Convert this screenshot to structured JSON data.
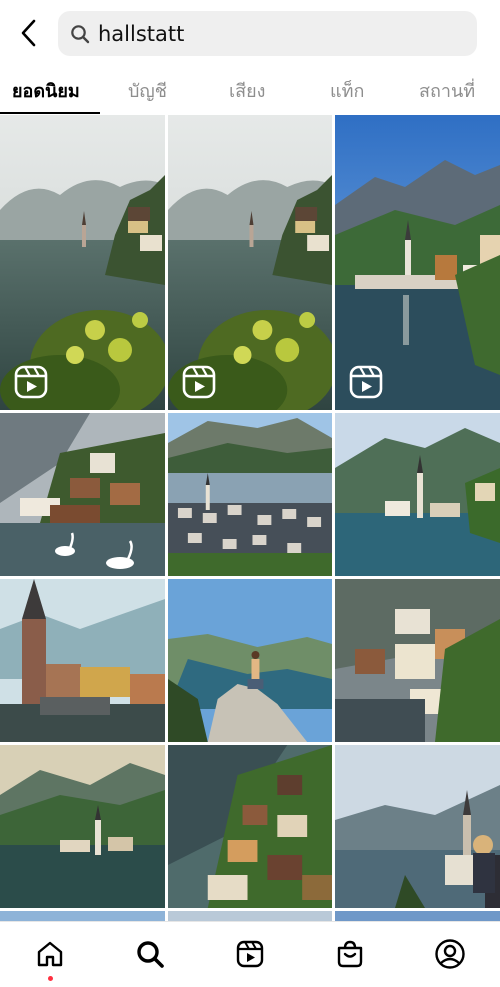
{
  "search": {
    "query": "hallstatt"
  },
  "tabs": [
    {
      "label": "ยอดนิยม",
      "active": true
    },
    {
      "label": "บัญชี"
    },
    {
      "label": "เสียง"
    },
    {
      "label": "แท็ก"
    },
    {
      "label": "สถานที่"
    }
  ],
  "grid": {
    "tiles": [
      {
        "reel": true,
        "scene": "misty-lake-village"
      },
      {
        "reel": true,
        "scene": "misty-lake-village"
      },
      {
        "reel": true,
        "scene": "sunny-lake-church"
      },
      {
        "scene": "village-swans"
      },
      {
        "scene": "aerial-village"
      },
      {
        "scene": "lake-church-green"
      },
      {
        "scene": "church-tower-closeup"
      },
      {
        "scene": "hiker-on-rock"
      },
      {
        "scene": "village-houses"
      },
      {
        "scene": "lake-panorama"
      },
      {
        "scene": "hillside-houses"
      },
      {
        "scene": "woman-viewpoint"
      }
    ]
  },
  "bottom_nav": {
    "items": [
      "home-icon",
      "search-icon",
      "reels-icon",
      "shop-icon",
      "profile-icon"
    ],
    "active": "search-icon",
    "notification_color": "#ff3040"
  }
}
